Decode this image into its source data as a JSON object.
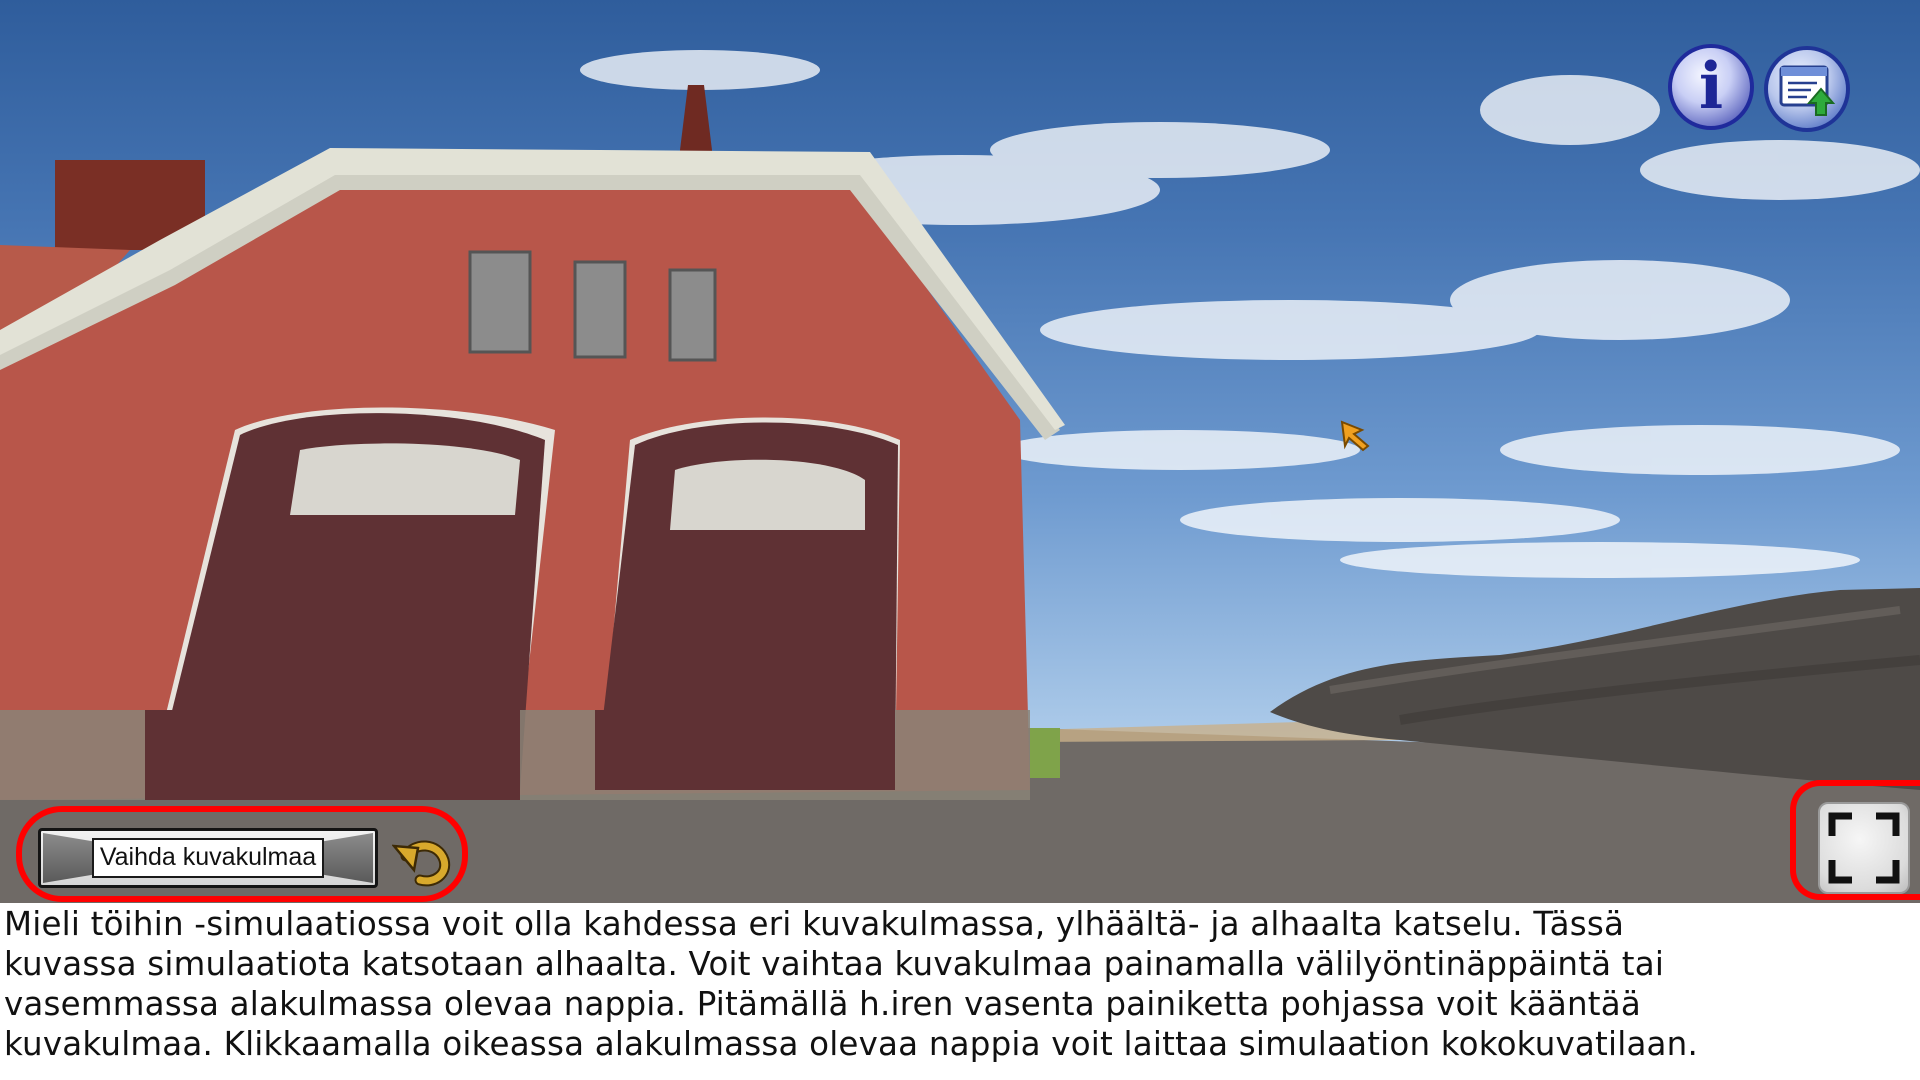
{
  "hud": {
    "info_icon": "info-icon",
    "info_glyph": "i",
    "export_icon": "export-window-icon",
    "fullscreen_icon": "fullscreen-icon",
    "rotate_icon": "rotate-camera-icon"
  },
  "camera_control": {
    "button_label": "Vaihda kuvakulmaa"
  },
  "highlight_color": "#ff0000",
  "description": {
    "text": "Mieli töihin -simulaatiossa voit olla kahdessa eri kuvakulmassa, ylhäältä- ja alhaalta katselu. Tässä\nkuvassa simulaatiota katsotaan alhaalta. Voit vaihtaa kuvakulmaa painamalla välilyöntinäppäintä tai\nvasemmassa alakulmassa olevaa nappia. Pitämällä h.iren vasenta painiketta pohjassa voit kääntää\nkuvakulmaa. Klikkaamalla oikeassa alakulmassa olevaa nappia voit laittaa simulaation kokokuvatilaan."
  }
}
